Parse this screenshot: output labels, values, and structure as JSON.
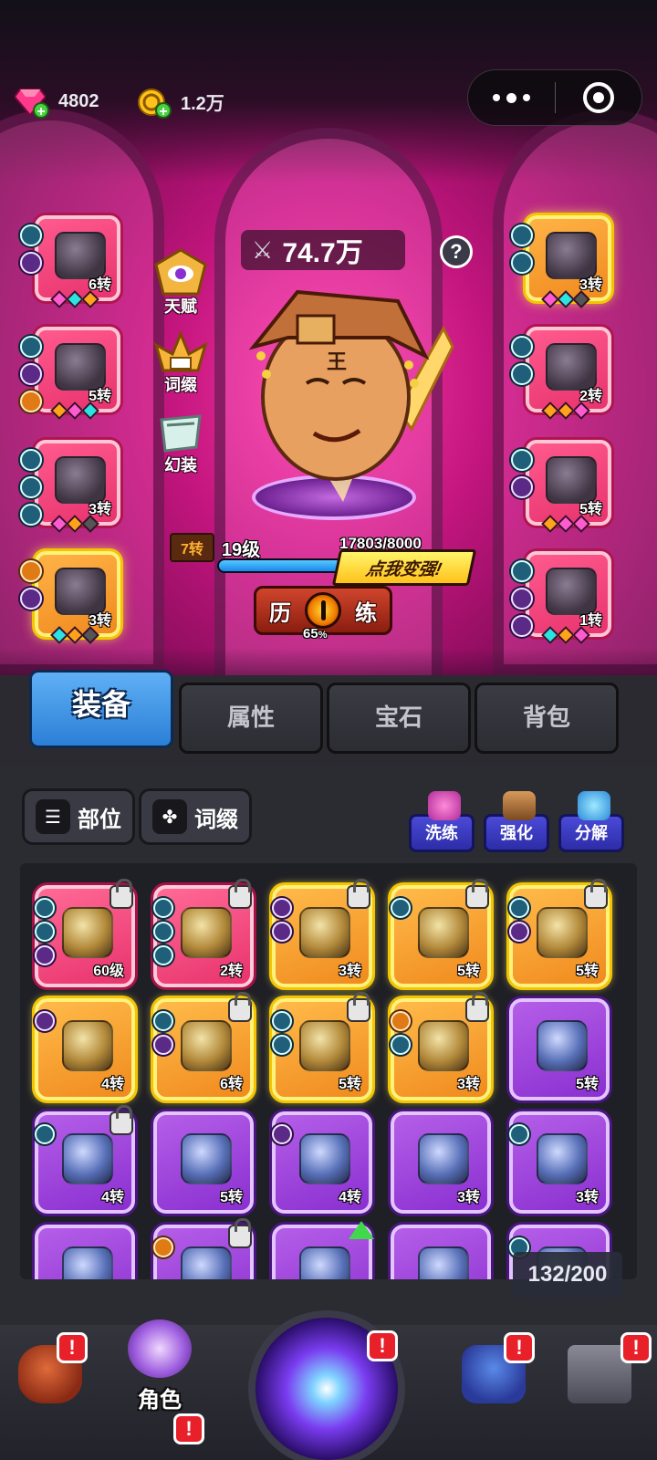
{
  "currencies": {
    "diamonds": "4802",
    "coins": "1.2万"
  },
  "colors": {
    "accent_blue": "#2b7fd6",
    "rarity_red": "#e8336e",
    "rarity_gold": "#f5c400",
    "rarity_purple": "#8a2fd0",
    "alert_red": "#e8202a"
  },
  "hero": {
    "power": "74.7万",
    "side_buttons": [
      {
        "label": "天赋",
        "icon": "eye-badge-icon"
      },
      {
        "label": "词缀",
        "icon": "wings-crest-icon"
      },
      {
        "label": "幻装",
        "icon": "phantom-armor-icon"
      }
    ],
    "rebirth": "7转",
    "level": "19级",
    "exp": "17803/8000",
    "exp_progress": 0.9,
    "promo": "点我变强!",
    "train": {
      "left": "历",
      "right": "练",
      "percent": "65",
      "unit": "%"
    }
  },
  "slots_left": [
    {
      "level": "6转",
      "rarity": "red",
      "icon": "golden-boots-icon"
    },
    {
      "level": "5转",
      "rarity": "red",
      "icon": "beast-pet-icon"
    },
    {
      "level": "3转",
      "rarity": "red",
      "icon": "dark-armor-icon"
    },
    {
      "level": "3转",
      "rarity": "gold",
      "icon": "leg-armor-icon"
    }
  ],
  "slots_right": [
    {
      "level": "3转",
      "rarity": "gold",
      "icon": "iron-boots-icon"
    },
    {
      "level": "2转",
      "rarity": "red",
      "icon": "claw-gauntlet-icon"
    },
    {
      "level": "5转",
      "rarity": "red",
      "icon": "gem-ring-icon"
    },
    {
      "level": "1转",
      "rarity": "red",
      "icon": "amulet-icon"
    }
  ],
  "tabs": [
    "装备",
    "属性",
    "宝石",
    "背包"
  ],
  "filters": {
    "slot": "部位",
    "affix": "词缀"
  },
  "actions": {
    "refine": "洗练",
    "enhance": "强化",
    "decompose": "分解"
  },
  "inventory": [
    {
      "level": "60级",
      "rarity": "red",
      "icon": "golden-sword-icon",
      "locked": true
    },
    {
      "level": "2转",
      "rarity": "red",
      "icon": "banana-icon",
      "locked": true
    },
    {
      "level": "3转",
      "rarity": "gold",
      "icon": "popsicle-icon",
      "locked": true
    },
    {
      "level": "5转",
      "rarity": "gold",
      "icon": "ring-icon",
      "locked": true
    },
    {
      "level": "5转",
      "rarity": "gold",
      "icon": "ring-icon",
      "locked": true
    },
    {
      "level": "4转",
      "rarity": "gold",
      "icon": "gem-ring-icon",
      "locked": false
    },
    {
      "level": "6转",
      "rarity": "gold",
      "icon": "winged-armor-icon",
      "locked": true
    },
    {
      "level": "5转",
      "rarity": "gold",
      "icon": "knight-armor-icon",
      "locked": true
    },
    {
      "level": "3转",
      "rarity": "gold",
      "icon": "necklace-icon",
      "locked": true
    },
    {
      "level": "5转",
      "rarity": "purple",
      "icon": "mace-icon",
      "locked": false
    },
    {
      "level": "4转",
      "rarity": "purple",
      "icon": "banana-icon",
      "locked": true
    },
    {
      "level": "5转",
      "rarity": "purple",
      "icon": "ring-icon",
      "locked": false
    },
    {
      "level": "4转",
      "rarity": "purple",
      "icon": "torch-icon",
      "locked": false
    },
    {
      "level": "3转",
      "rarity": "purple",
      "icon": "syringe-icon",
      "locked": false
    },
    {
      "level": "3转",
      "rarity": "purple",
      "icon": "club-icon",
      "locked": false
    },
    {
      "level": "",
      "rarity": "purple",
      "icon": "ring-icon",
      "locked": false
    },
    {
      "level": "",
      "rarity": "purple",
      "icon": "hat-icon",
      "locked": true
    },
    {
      "level": "",
      "rarity": "purple",
      "icon": "armor-icon",
      "locked": false,
      "upgrade": true
    },
    {
      "level": "",
      "rarity": "purple",
      "icon": "ring-icon",
      "locked": false
    },
    {
      "level": "",
      "rarity": "purple",
      "icon": "helmet-icon",
      "locked": false
    }
  ],
  "capacity": "132/200",
  "nav": {
    "items": [
      {
        "label": "",
        "icon": "treasure-bag-icon",
        "alert": "!"
      },
      {
        "label": "角色",
        "icon": "crown-character-icon",
        "alert": "!"
      },
      {
        "label": "",
        "icon": "portal-icon",
        "alert": "!"
      },
      {
        "label": "",
        "icon": "monster-icon",
        "alert": "!"
      },
      {
        "label": "",
        "icon": "dungeon-gate-icon",
        "alert": "!"
      }
    ]
  }
}
